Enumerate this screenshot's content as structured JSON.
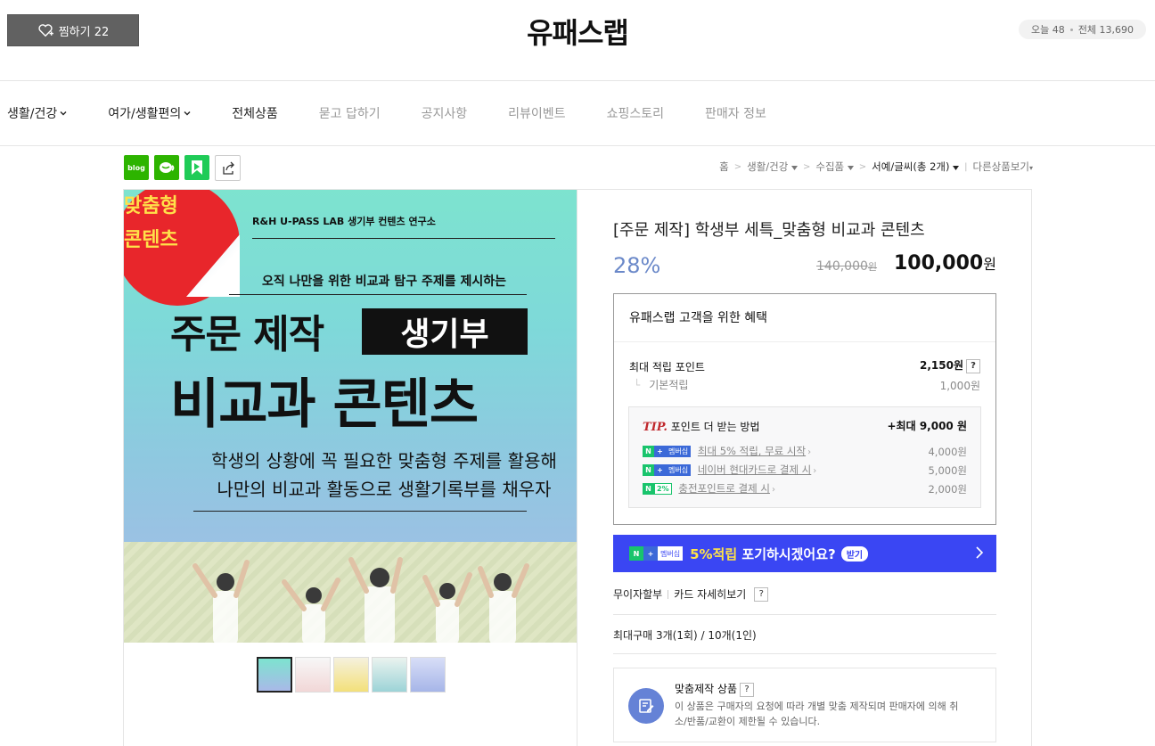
{
  "header": {
    "zzim_label": "찜하기 22",
    "store_title": "유패스랩",
    "visits_today": "오늘 48",
    "visits_total": "전체 13,690"
  },
  "nav": {
    "items": [
      {
        "label": "생활/건강"
      },
      {
        "label": "여가/생활편의"
      },
      {
        "label": "전체상품"
      },
      {
        "label": "묻고 답하기"
      },
      {
        "label": "공지사항"
      },
      {
        "label": "리뷰이벤트"
      },
      {
        "label": "쇼핑스토리"
      },
      {
        "label": "판매자 정보"
      }
    ]
  },
  "share": {
    "blog": "blog"
  },
  "breadcrumb": {
    "home": "홈",
    "cat1": "생활/건강",
    "cat2": "수집품",
    "cat3": "서예/글씨(총 2개)",
    "other": "다른상품보기"
  },
  "product_image": {
    "sticker": [
      "맞춤형",
      "콘텐츠"
    ],
    "lab": "R&H U-PASS LAB 생기부 컨텐츠 연구소",
    "sub": "오직 나만을 위한 비교과 탐구 주제를 제시하는",
    "big1": "주문 제작",
    "box": "생기부",
    "big2": "비교과 콘텐츠",
    "desc1": "학생의 상황에 꼭 필요한 맞춤형 주제를 활용해",
    "desc2": "나만의 비교과 활동으로 생활기록부를 채우자"
  },
  "product": {
    "title": "[주문 제작] 학생부 세특_맞춤형 비교과 콘텐츠",
    "discount": "28%",
    "original_price": "140,000",
    "price": "100,000",
    "won": "원"
  },
  "benefit": {
    "header": "유패스랩 고객을 위한 혜택",
    "max_points_label": "최대 적립 포인트",
    "max_points_value": "2,150원",
    "basic_label": "기본적립",
    "basic_value": "1,000원",
    "tip_prefix": "TIP.",
    "tip_label": "포인트 더 받는 방법",
    "tip_max": "+최대 9,000 원",
    "tips": [
      {
        "tag": "멤버십",
        "text": "최대 5% 적립, 무료 시작",
        "value": "4,000원"
      },
      {
        "tag": "멤버십",
        "text": "네이버 현대카드로 결제 시",
        "value": "5,000원"
      },
      {
        "tag": "2%",
        "text": "충전포인트로 결제 시",
        "value": "2,000원"
      }
    ]
  },
  "banner": {
    "tag": "멤버십",
    "highlight": "5%적립",
    "text": "포기하시겠어요?",
    "get": "받기"
  },
  "installment": {
    "label": "무이자할부",
    "card_label": "카드 자세히보기"
  },
  "max_buy": "최대구매 3개(1회) / 10개(1인)",
  "custom": {
    "title": "맞춤제작 상품",
    "desc": "이 상품은 구매자의 요청에 따라 개별 맞춤 제작되며 판매자에 의해 취소/반품/교환이 제한될 수 있습니다."
  },
  "question_mark": "?"
}
